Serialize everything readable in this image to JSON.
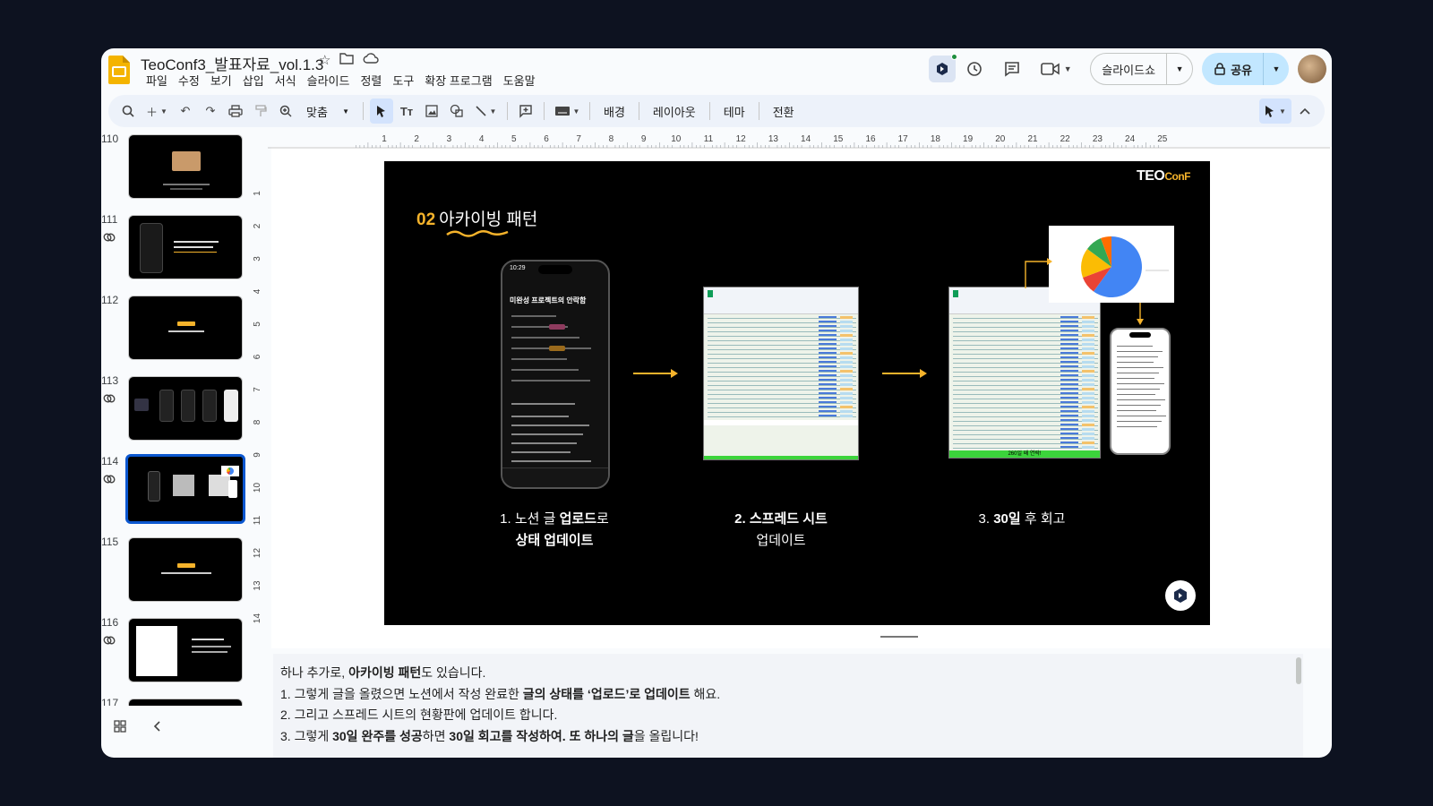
{
  "app": {
    "doc_title": "TeoConf3_발표자료_vol.1.3",
    "menu": [
      "파일",
      "수정",
      "보기",
      "삽입",
      "서식",
      "슬라이드",
      "정렬",
      "도구",
      "확장 프로그램",
      "도움말"
    ]
  },
  "header": {
    "slideshow_label": "슬라이드쇼",
    "share_label": "공유"
  },
  "toolbar": {
    "zoom_label": "맞춤",
    "background_label": "배경",
    "layout_label": "레이아웃",
    "theme_label": "테마",
    "transition_label": "전환"
  },
  "filmstrip": {
    "slides": [
      {
        "num": "110",
        "linked": false
      },
      {
        "num": "111",
        "linked": true
      },
      {
        "num": "112",
        "linked": false
      },
      {
        "num": "113",
        "linked": true
      },
      {
        "num": "114",
        "linked": true,
        "selected": true
      },
      {
        "num": "115",
        "linked": false
      },
      {
        "num": "116",
        "linked": true
      },
      {
        "num": "117",
        "linked": false
      }
    ]
  },
  "ruler": {
    "h_ticks": [
      "1",
      "2",
      "3",
      "4",
      "5",
      "6",
      "7",
      "8",
      "9",
      "10",
      "11",
      "12",
      "13",
      "14",
      "15",
      "16",
      "17",
      "18",
      "19",
      "20",
      "21",
      "22",
      "23",
      "24",
      "25"
    ],
    "v_ticks": [
      "1",
      "2",
      "3",
      "4",
      "5",
      "6",
      "7",
      "8",
      "9",
      "10",
      "11",
      "12",
      "13",
      "14"
    ]
  },
  "slide": {
    "logo_main": "TEO",
    "logo_accent": "ConF",
    "title_num": "02",
    "title_text": "아카이빙 패턴",
    "phone_title": "미완성 프로젝트의 안락함",
    "phone_time": "10:29",
    "step1_line1_a": "1. 노션 글 ",
    "step1_line1_b": "업로드",
    "step1_line1_c": "로",
    "step1_line2": "상태 업데이트",
    "step2_line1": "2. 스프레드 시트",
    "step2_line2": "업데이트",
    "step3_a": "3. ",
    "step3_b": "30일",
    "step3_c": " 후 회고",
    "sheet_footer": "260일 째 연락!"
  },
  "notes": {
    "line0_a": "하나 추가로, ",
    "line0_b": "아카이빙 패턴",
    "line0_c": "도 있습니다.",
    "line1_a": "1. 그렇게 글을 올렸으면 노션에서 작성 완료한 ",
    "line1_b": "글의 상태를 ‘업로드’로 업데이트",
    "line1_c": " 해요.",
    "line2": "2. 그리고 스프레드 시트의 현황판에 업데이트 합니다.",
    "line3_a": "3. 그렇게 ",
    "line3_b": "30일 완주를 성공",
    "line3_c": "하면 ",
    "line3_d": "30일 회고를 작성하여. 또 하나의 글",
    "line3_e": "을 올립니다!"
  },
  "colors": {
    "accent_yellow": "#f5b32b",
    "selected_border": "#0b57d0",
    "share_bg": "#c2e7ff"
  }
}
